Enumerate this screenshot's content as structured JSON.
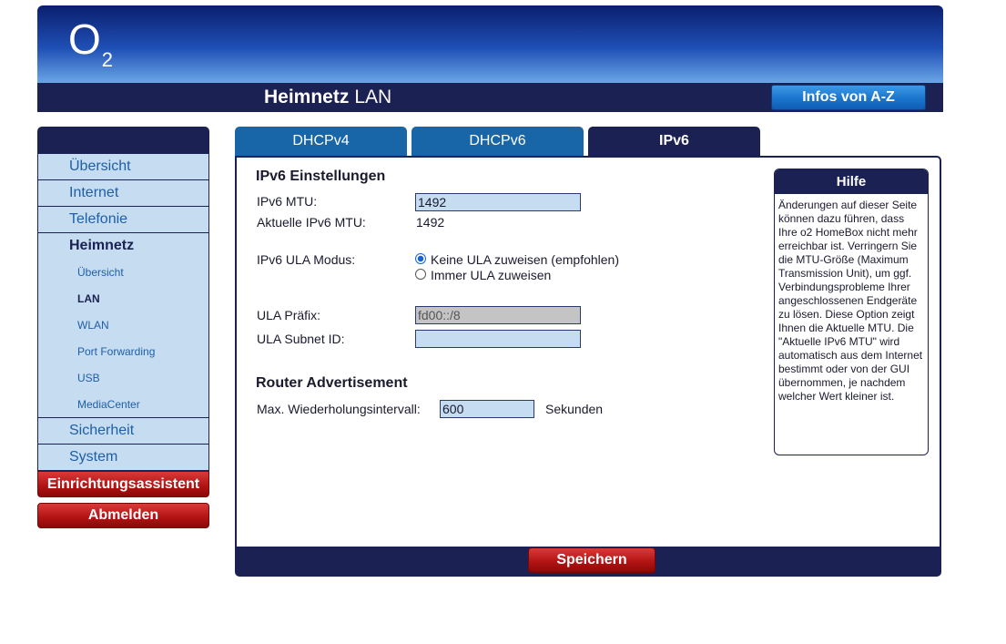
{
  "header": {
    "logo_main": "O",
    "logo_sub": "2",
    "title_bold": "Heimnetz",
    "title_rest": "LAN",
    "infos_button": "Infos von A-Z"
  },
  "sidebar": {
    "items": [
      {
        "label": "Übersicht"
      },
      {
        "label": "Internet"
      },
      {
        "label": "Telefonie"
      },
      {
        "label": "Heimnetz"
      }
    ],
    "subitems": [
      {
        "label": "Übersicht"
      },
      {
        "label": "LAN"
      },
      {
        "label": "WLAN"
      },
      {
        "label": "Port Forwarding"
      },
      {
        "label": "USB"
      },
      {
        "label": "MediaCenter"
      }
    ],
    "after": [
      {
        "label": "Sicherheit"
      },
      {
        "label": "System"
      }
    ],
    "assistant": "Einrichtungsassistent",
    "logout": "Abmelden"
  },
  "tabs": [
    {
      "label": "DHCPv4"
    },
    {
      "label": "DHCPv6"
    },
    {
      "label": "IPv6"
    }
  ],
  "form": {
    "section_title": "IPv6 Einstellungen",
    "mtu_label": "IPv6 MTU:",
    "mtu_value": "1492",
    "current_mtu_label": "Aktuelle IPv6 MTU:",
    "current_mtu_value": "1492",
    "ula_mode_label": "IPv6 ULA Modus:",
    "ula_options": [
      {
        "label": "Keine ULA zuweisen (empfohlen)",
        "selected": true
      },
      {
        "label": "Immer ULA zuweisen",
        "selected": false
      }
    ],
    "ula_prefix_label": "ULA Präfix:",
    "ula_prefix_value": "fd00::/8",
    "ula_subnet_label": "ULA Subnet ID:",
    "ula_subnet_value": "",
    "ra_title": "Router Advertisement",
    "ra_interval_label": "Max. Wiederholungsintervall:",
    "ra_interval_value": "600",
    "ra_interval_unit": "Sekunden"
  },
  "help": {
    "title": "Hilfe",
    "text": "Änderungen auf dieser Seite können dazu führen, dass Ihre o2 HomeBox nicht mehr erreichbar ist. Verringern Sie die MTU-Größe (Maximum Transmission Unit), um ggf. Verbindungsprobleme Ihrer angeschlossenen Endgeräte zu lösen. Diese Option zeigt Ihnen die Aktuelle MTU. Die \"Aktuelle IPv6 MTU\" wird automatisch aus dem Internet bestimmt oder von der GUI übernommen, je nachdem welcher Wert kleiner ist."
  },
  "footer": {
    "save_button": "Speichern"
  },
  "colors": {
    "navy": "#1b2152",
    "tab_blue": "#1866a8",
    "sidebar_bg": "#c5dcf1",
    "accent_red": "#b41414"
  }
}
